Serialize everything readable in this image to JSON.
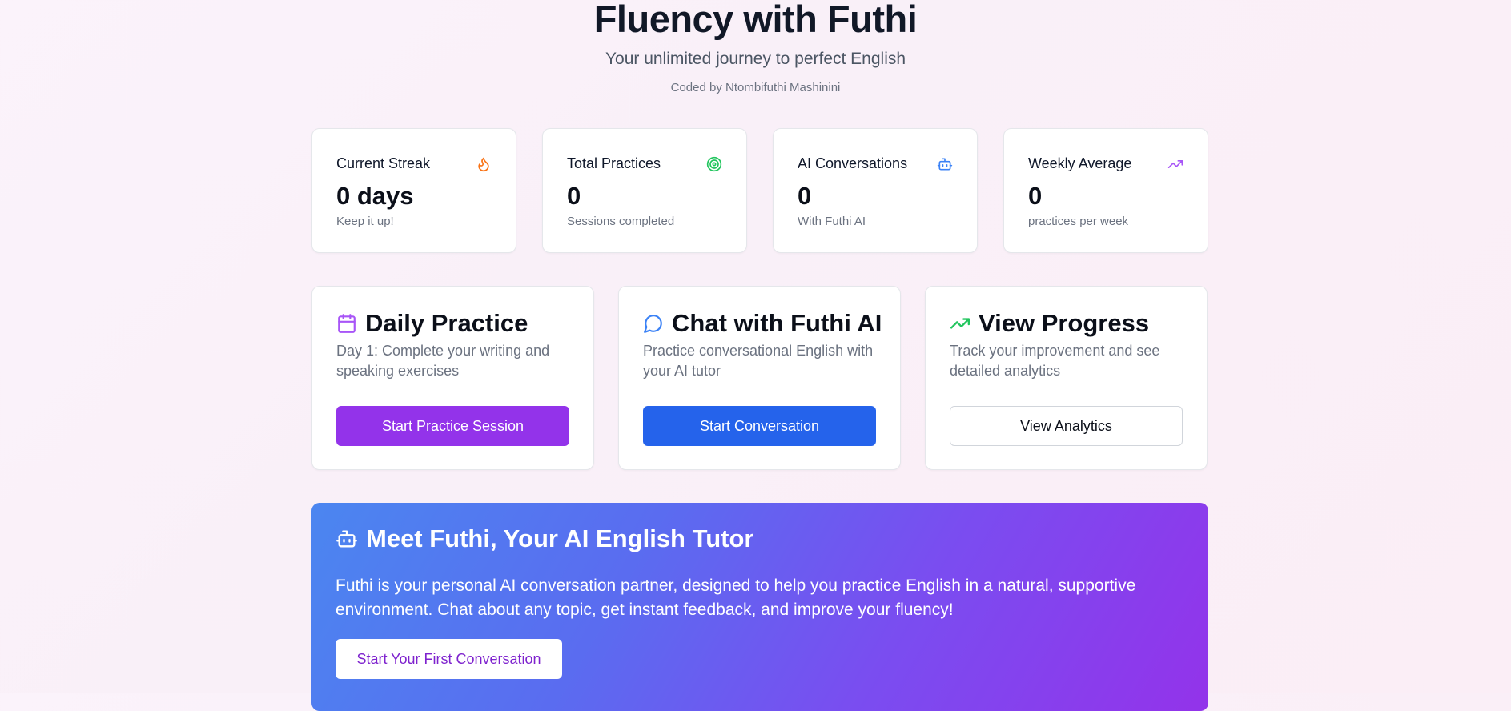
{
  "header": {
    "title": "Fluency with Futhi",
    "subtitle": "Your unlimited journey to perfect English",
    "credit": "Coded by Ntombifuthi Mashinini"
  },
  "stats": [
    {
      "label": "Current Streak",
      "value": "0 days",
      "caption": "Keep it up!",
      "icon": "flame-icon",
      "color": "#f97316"
    },
    {
      "label": "Total Practices",
      "value": "0",
      "caption": "Sessions completed",
      "icon": "target-icon",
      "color": "#22c55e"
    },
    {
      "label": "AI Conversations",
      "value": "0",
      "caption": "With Futhi AI",
      "icon": "bot-icon",
      "color": "#3b82f6"
    },
    {
      "label": "Weekly Average",
      "value": "0",
      "caption": "practices per week",
      "icon": "trending-up-icon",
      "color": "#a855f7"
    }
  ],
  "actions": [
    {
      "title": "Daily Practice",
      "description": "Day 1: Complete your writing and speaking exercises",
      "button": "Start Practice Session",
      "icon": "calendar-icon",
      "color": "#a855f7"
    },
    {
      "title": "Chat with Futhi AI",
      "description": "Practice conversational English with your AI tutor",
      "button": "Start Conversation",
      "icon": "chat-bubble-icon",
      "color": "#3b82f6"
    },
    {
      "title": "View Progress",
      "description": "Track your improvement and see detailed analytics",
      "button": "View Analytics",
      "icon": "trending-up-icon",
      "color": "#22c55e"
    }
  ],
  "hero": {
    "title": "Meet Futhi, Your AI English Tutor",
    "text": "Futhi is your personal AI conversation partner, designed to help you practice English in a natural, supportive environment. Chat about any topic, get instant feedback, and improve your fluency!",
    "button": "Start Your First Conversation",
    "icon": "bot-icon"
  }
}
